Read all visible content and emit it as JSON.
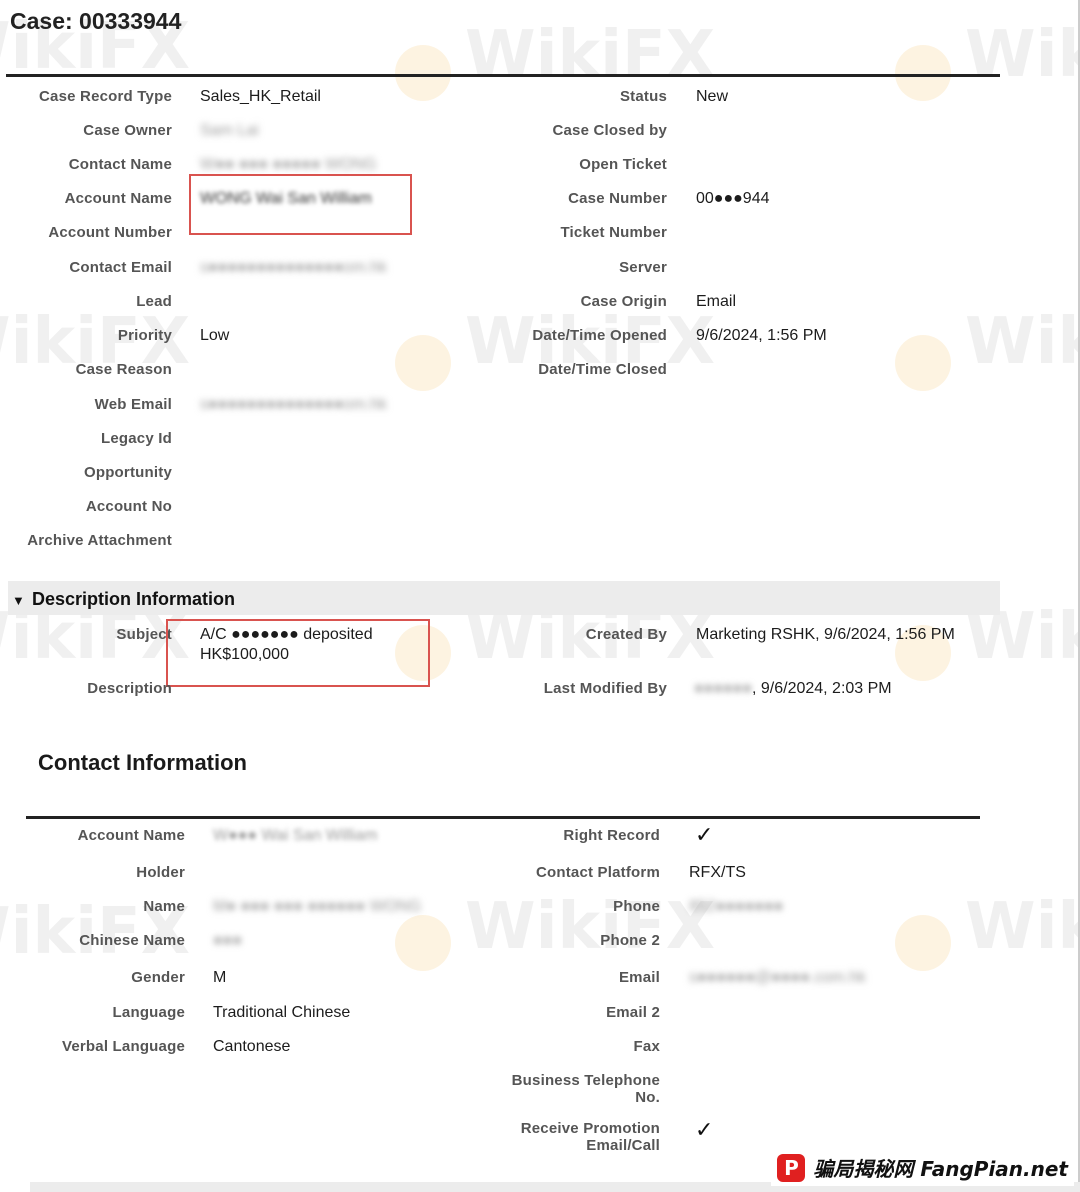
{
  "case": {
    "title": "Case: 00333944"
  },
  "case_fields_left": [
    {
      "label": "Case Record Type",
      "value": "Sales_HK_Retail",
      "blurred": false
    },
    {
      "label": "Case Owner",
      "value": "Sam Lai",
      "blurred": true
    },
    {
      "label": "Contact Name",
      "value": "W●● ●●● ●●●●● WONG",
      "blurred": true
    },
    {
      "label": "Account Name",
      "value": "WONG Wai San William",
      "blurred": true
    },
    {
      "label": "Account Number",
      "value": "",
      "blurred": false
    },
    {
      "label": "Contact Email",
      "value": "s●●●●●●●●●●●●●●om.hk",
      "blurred": true
    },
    {
      "label": "Lead",
      "value": "",
      "blurred": false
    },
    {
      "label": "Priority",
      "value": "Low",
      "blurred": false
    },
    {
      "label": "Case Reason",
      "value": "",
      "blurred": false
    },
    {
      "label": "Web Email",
      "value": "s●●●●●●●●●●●●●●om.hk",
      "blurred": true
    },
    {
      "label": "Legacy Id",
      "value": "",
      "blurred": false
    },
    {
      "label": "Opportunity",
      "value": "",
      "blurred": false
    },
    {
      "label": "Account No",
      "value": "",
      "blurred": false
    },
    {
      "label": "Archive Attachment",
      "value": "",
      "blurred": false
    }
  ],
  "case_fields_right": [
    {
      "label": "Status",
      "value": "New"
    },
    {
      "label": "Case Closed by",
      "value": ""
    },
    {
      "label": "Open Ticket",
      "value": ""
    },
    {
      "label": "Case Number",
      "value": "00●●●944"
    },
    {
      "label": "Ticket Number",
      "value": ""
    },
    {
      "label": "Server",
      "value": ""
    },
    {
      "label": "Case Origin",
      "value": "Email"
    },
    {
      "label": "Date/Time Opened",
      "value": "9/6/2024, 1:56 PM"
    },
    {
      "label": "Date/Time Closed",
      "value": ""
    }
  ],
  "description_section": {
    "title": "Description Information",
    "subject_label": "Subject",
    "subject_line1": "A/C ●●●●●●● deposited",
    "subject_line2": "HK$100,000",
    "description_label": "Description",
    "created_by_label": "Created By",
    "created_by_value": "Marketing RSHK, 9/6/2024, 1:56 PM",
    "last_modified_label": "Last Modified By",
    "last_modified_blur": "●●●●●●",
    "last_modified_value": ", 9/6/2024, 2:03 PM"
  },
  "contact_section": {
    "title": "Contact Information",
    "left": [
      {
        "label": "Account Name",
        "value": "W●●● Wai San William",
        "blurred": true
      },
      {
        "label": "Holder",
        "value": "",
        "blurred": false
      },
      {
        "label": "Name",
        "value": "M● ●●● ●●● ●●●●●● WONG",
        "blurred": true
      },
      {
        "label": "Chinese Name",
        "value": "●●●",
        "blurred": true
      },
      {
        "label": "Gender",
        "value": "M",
        "blurred": false
      },
      {
        "label": "Language",
        "value": "Traditional Chinese",
        "blurred": false
      },
      {
        "label": "Verbal Language",
        "value": "Cantonese",
        "blurred": false
      }
    ],
    "right": {
      "right_record_label": "Right Record",
      "contact_platform_label": "Contact Platform",
      "contact_platform_value": "RFX/TS",
      "phone_label": "Phone",
      "phone_value": "852●●●●●●●",
      "phone2_label": "Phone 2",
      "email_label": "Email",
      "email_value": "s●●●●●●@●●●●.com.hk",
      "email2_label": "Email 2",
      "fax_label": "Fax",
      "business_tel_label_1": "Business Telephone",
      "business_tel_label_2": "No.",
      "promo_label_1": "Receive Promotion",
      "promo_label_2": "Email/Call"
    }
  },
  "watermark": {
    "text": "WikiFX"
  },
  "footer": {
    "logo_letter": "P",
    "text": "骗局揭秘网 FangPian.net"
  },
  "check_glyph": "✓"
}
